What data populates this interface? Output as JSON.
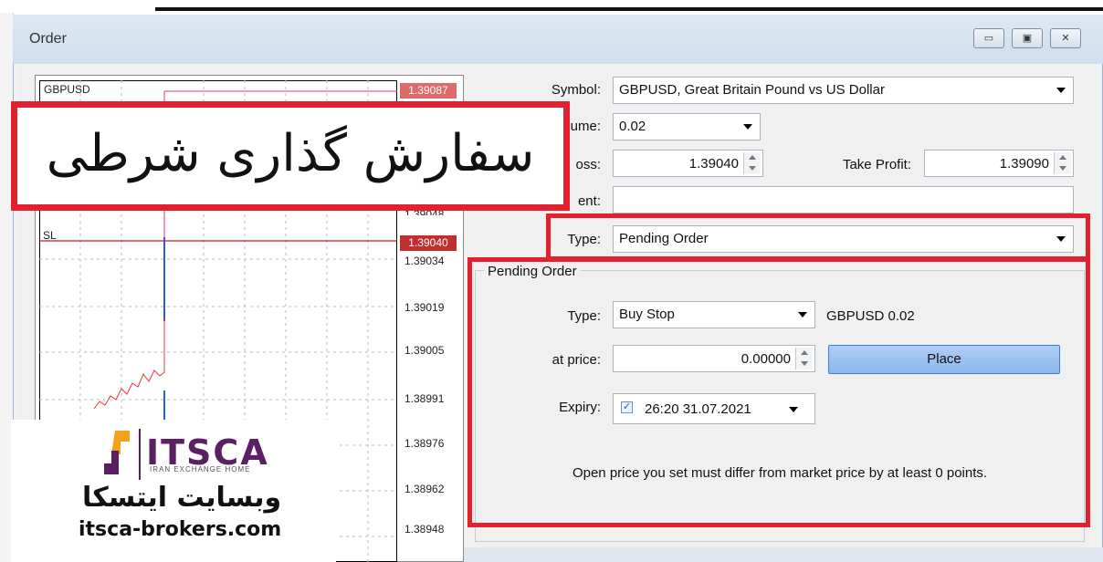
{
  "window": {
    "title": "Order",
    "buttons": [
      "▭",
      "▣",
      "✕"
    ]
  },
  "chart": {
    "symbol_label": "GBPUSD",
    "sl_label": "SL",
    "tp_price_tag": "1.39087",
    "sl_price_tag": "1.39040",
    "partial_price_label": "1.39048",
    "price_axis": [
      "1.39034",
      "1.39019",
      "1.39005",
      "1.38991",
      "1.38976",
      "1.38962",
      "1.38948"
    ]
  },
  "form": {
    "symbol_label": "Symbol:",
    "symbol_value": "GBPUSD, Great Britain Pound vs US Dollar",
    "volume_label": "ume:",
    "volume_value": "0.02",
    "stoploss_label": "oss:",
    "stoploss_value": "1.39040",
    "takeprofit_label": "Take Profit:",
    "takeprofit_value": "1.39090",
    "comment_label": "ent:",
    "comment_value": "",
    "type_label": "Type:",
    "type_value": "Pending Order"
  },
  "pending": {
    "group_title": "Pending Order",
    "type_label": "Type:",
    "type_value": "Buy Stop",
    "symbol_volume": "GBPUSD 0.02",
    "price_label": "at price:",
    "price_value": "0.00000",
    "place_button": "Place",
    "expiry_label": "Expiry:",
    "expiry_checked": true,
    "expiry_check_glyph": "✓",
    "expiry_value": "26:20 31.07.2021",
    "note": "Open price you set must differ from market price by at least 0 points."
  },
  "overlay": {
    "heading": "سفارش گذاری شرطی",
    "logo_text": "ITSCA",
    "logo_tagline": "IRAN EXCHANGE HOME",
    "site_name": "وبسایت ایتسکا",
    "site_url": "itsca-brokers.com"
  },
  "colors": {
    "highlight_red": "#e3202d",
    "tp_tag": "#e06a6a",
    "sl_tag": "#c0302f",
    "place_button": "#9fc4f2",
    "logo_purple": "#5b1f63",
    "logo_orange": "#f2a31b"
  }
}
